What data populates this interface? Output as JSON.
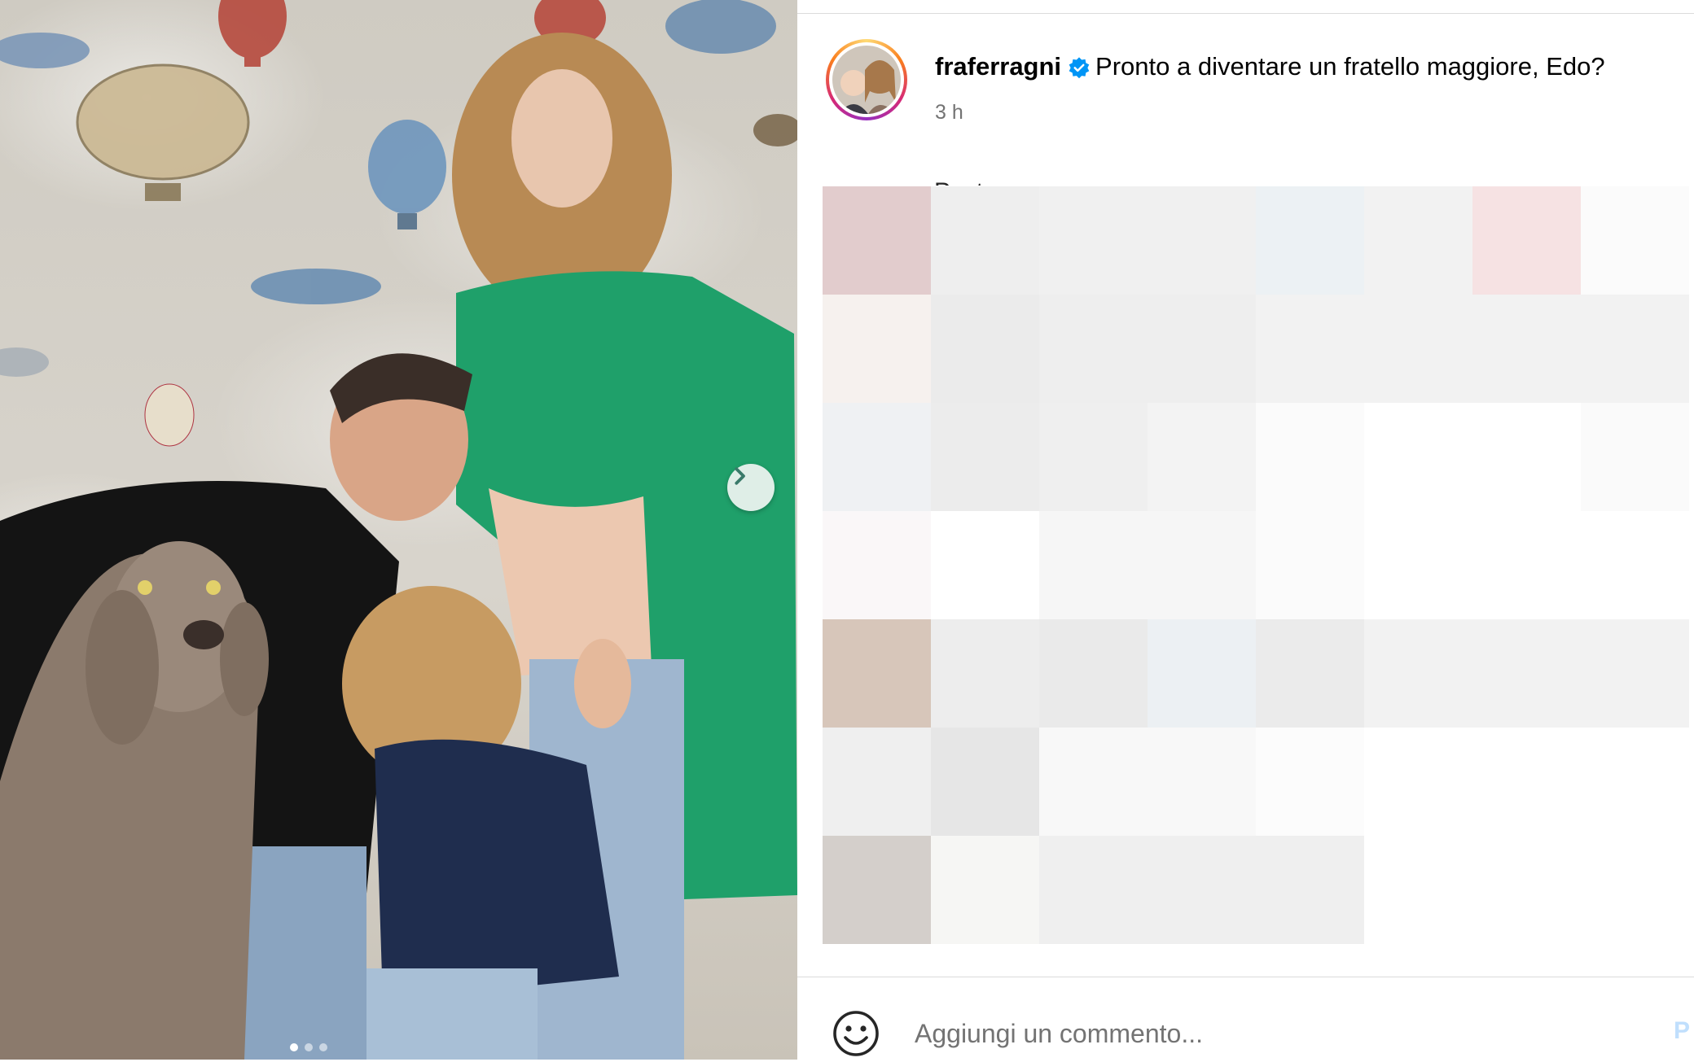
{
  "post": {
    "username": "fraferragni",
    "caption": "Pronto a diventare un fratello maggiore, Edo?",
    "time": "3 h",
    "partial_text": "Post"
  },
  "comment": {
    "placeholder": "Aggiungi un commento...",
    "publish_label": "P"
  },
  "carousel": {
    "count": 3,
    "active_index": 0
  },
  "colors": {
    "verified": "#0095f6",
    "accent_light": "#c0dffd",
    "divider": "#dbdbdb",
    "muted_text": "#737373",
    "sweater": "#1fa06a"
  },
  "icons": {
    "next": "chevron-right-icon",
    "verified": "verified-badge-icon",
    "emoji": "smiley-face-icon"
  }
}
